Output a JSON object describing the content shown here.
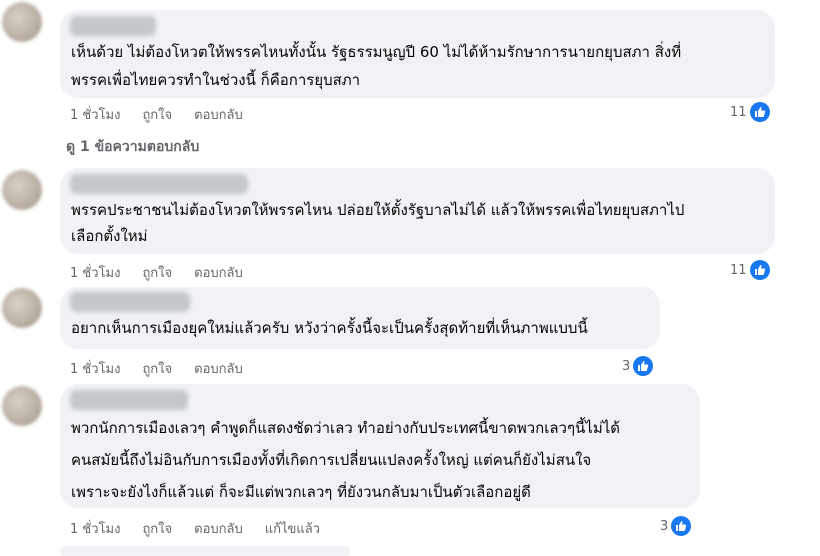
{
  "comments": [
    {
      "lines": [
        "เห็นด้วย ไม่ต้องโหวตให้พรรคไหนทั้งนั้น รัฐธรรมนูญปี 60 ไม่ได้ห้ามรักษาการนายกยุบสภา สิ่งที่",
        "พรรคเพื่อไทยควรทำในช่วงนี้ ก็คือการยุบสภา"
      ],
      "time": "1 ชั่วโมง",
      "like": "ถูกใจ",
      "reply": "ตอบกลับ",
      "reactions": "11"
    },
    {
      "lines": [
        "พรรคประชาชนไม่ต้องโหวตให้พรรคไหน ปล่อยให้ตั้งรัฐบาลไม่ได้ แล้วให้พรรคเพื่อไทยยุบสภาไป",
        "เลือกตั้งใหม่"
      ],
      "time": "1 ชั่วโมง",
      "like": "ถูกใจ",
      "reply": "ตอบกลับ",
      "reactions": "11"
    },
    {
      "lines": [
        "อยากเห็นการเมืองยุคใหม่แล้วครับ หวังว่าครั้งนี้จะเป็นครั้งสุดท้ายที่เห็นภาพแบบนี้"
      ],
      "time": "1 ชั่วโมง",
      "like": "ถูกใจ",
      "reply": "ตอบกลับ",
      "reactions": "3"
    },
    {
      "lines": [
        "พวกนักการเมืองเลวๆ คำพูดก็แสดงชัดว่าเลว ทำอย่างกับประเทศนี้ขาดพวกเลวๆนี้ไม่ได้",
        "คนสมัยนี้ถึงไม่อินกับการเมืองทั้งที่เกิดการเปลี่ยนแปลงครั้งใหญ่ แต่คนก็ยังไม่สนใจ",
        "เพราะจะยังไงก็แล้วแต่ ก็จะมีแต่พวกเลวๆ ที่ยังวนกลับมาเป็นตัวเลือกอยู่ดี"
      ],
      "time": "1 ชั่วโมง",
      "like": "ถูกใจ",
      "reply": "ตอบกลับ",
      "edited": "แก้ไขแล้ว",
      "reactions": "3"
    }
  ],
  "view_replies": "ดู 1 ข้อความตอบกลับ",
  "colors": {
    "bubble": "#f0f2f5",
    "like_blue": "#1877f2",
    "meta": "#65676b"
  }
}
